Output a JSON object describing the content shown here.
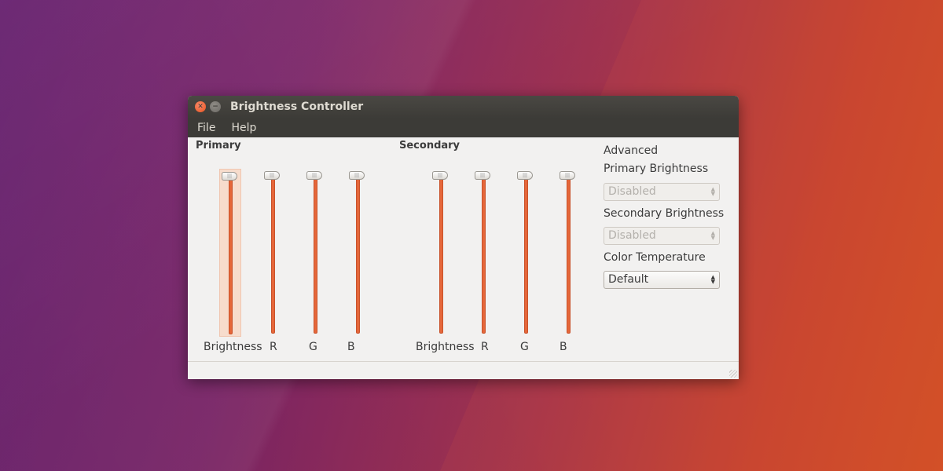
{
  "window": {
    "title": "Brightness Controller"
  },
  "menu": {
    "file": "File",
    "help": "Help"
  },
  "primary": {
    "title": "Primary",
    "sliders": [
      {
        "label": "Brightness",
        "value": 100
      },
      {
        "label": "R",
        "value": 100
      },
      {
        "label": "G",
        "value": 100
      },
      {
        "label": "B",
        "value": 100
      }
    ]
  },
  "secondary": {
    "title": "Secondary",
    "sliders": [
      {
        "label": "Brightness",
        "value": 100
      },
      {
        "label": "R",
        "value": 100
      },
      {
        "label": "G",
        "value": 100
      },
      {
        "label": "B",
        "value": 100
      }
    ]
  },
  "advanced": {
    "heading": "Advanced",
    "primary_brightness_label": "Primary Brightness",
    "primary_brightness_value": "Disabled",
    "secondary_brightness_label": "Secondary Brightness",
    "secondary_brightness_value": "Disabled",
    "color_temperature_label": "Color Temperature",
    "color_temperature_value": "Default"
  },
  "colors": {
    "accent": "#e5673a",
    "titlebar": "#3c3b37",
    "window_bg": "#f2f1f0"
  },
  "icons": {
    "close": "close-icon",
    "minimize": "minimize-icon"
  }
}
